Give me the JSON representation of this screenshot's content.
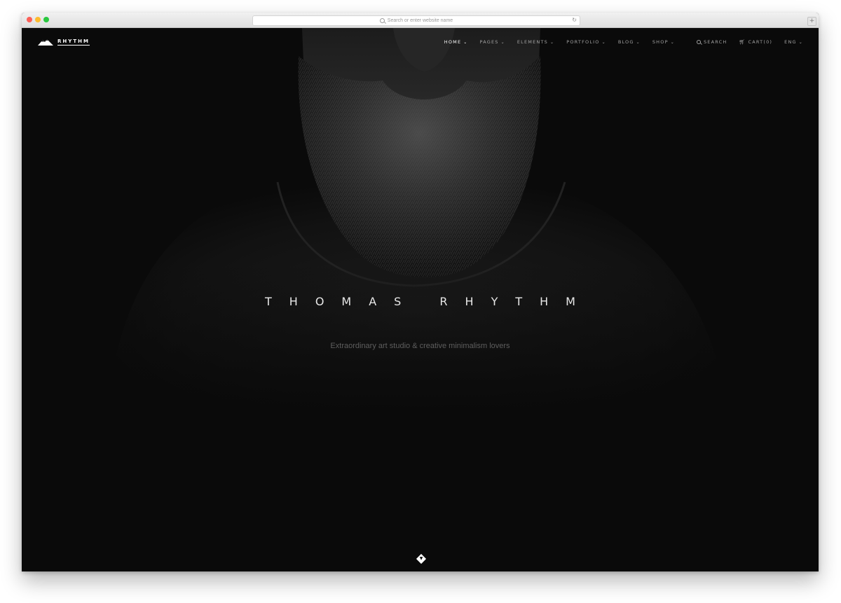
{
  "browser": {
    "address_placeholder": "Search or enter website name",
    "reload_icon": "reload-icon",
    "new_tab_icon": "plus-icon"
  },
  "site": {
    "logo_text": "RHYTHM",
    "logo_icon": "mountain-icon"
  },
  "nav": {
    "items": [
      {
        "label": "HOME",
        "active": true
      },
      {
        "label": "PAGES"
      },
      {
        "label": "ELEMENTS"
      },
      {
        "label": "PORTFOLIO"
      },
      {
        "label": "BLOG"
      },
      {
        "label": "SHOP"
      }
    ],
    "search_label": "SEARCH",
    "cart_label": "CART(0)",
    "language_label": "ENG"
  },
  "hero": {
    "title": "THOMAS RHYTHM",
    "subtitle": "Extraordinary art studio & creative minimalism lovers",
    "scroll_icon": "chevron-down-icon"
  },
  "colors": {
    "background": "#0a0a0a",
    "text_primary": "#ffffff",
    "text_muted": "#5e5e5e"
  }
}
